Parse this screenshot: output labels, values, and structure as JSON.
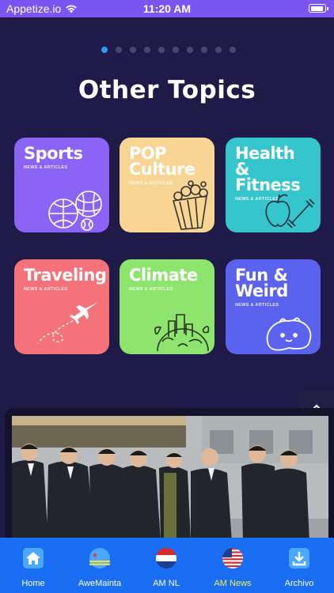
{
  "status_bar": {
    "carrier": "Appetize.io",
    "time": "11:20 AM"
  },
  "pager": {
    "count": 10,
    "active_index": 0
  },
  "section_title": "Other Topics",
  "topics": [
    {
      "title_line1": "Sports",
      "title_line2": "",
      "subtitle": "NEWS & ARTICLES",
      "color": "#8b63f5",
      "icon": "sports-balls-icon"
    },
    {
      "title_line1": "POP",
      "title_line2": "Culture",
      "subtitle": "NEWS & ARTICLES",
      "color": "#f8d592",
      "icon": "popcorn-icon"
    },
    {
      "title_line1": "Health &",
      "title_line2": "Fitness",
      "subtitle": "NEWS & ARTICLES",
      "color": "#35c5cc",
      "icon": "apple-dumbbell-icon"
    },
    {
      "title_line1": "Traveling",
      "title_line2": "",
      "subtitle": "NEWS & ARTICLES",
      "color": "#f6727a",
      "icon": "airplane-icon"
    },
    {
      "title_line1": "Climate",
      "title_line2": "",
      "subtitle": "NEWS & ARTICLES",
      "color": "#8de56d",
      "icon": "globe-city-icon"
    },
    {
      "title_line1": "Fun &",
      "title_line2": "Weird",
      "subtitle": "NEWS & ARTICLES",
      "color": "#5b63ee",
      "icon": "blob-creature-icon"
    }
  ],
  "tabs": [
    {
      "label": "Home",
      "icon": "house-icon",
      "selected": false
    },
    {
      "label": "AweMainta",
      "icon": "aruba-flag-icon",
      "selected": false
    },
    {
      "label": "AM NL",
      "icon": "netherlands-flag-icon",
      "selected": false
    },
    {
      "label": "AM News",
      "icon": "usa-flag-icon",
      "selected": true
    },
    {
      "label": "Archivo",
      "icon": "download-icon",
      "selected": false
    }
  ],
  "colors": {
    "background": "#1f1a48",
    "status_bar": "#7a55f2",
    "tab_bar": "#1a6ef3",
    "tab_selected": "#f5ef4c",
    "dot_active": "#2f9bf5"
  }
}
